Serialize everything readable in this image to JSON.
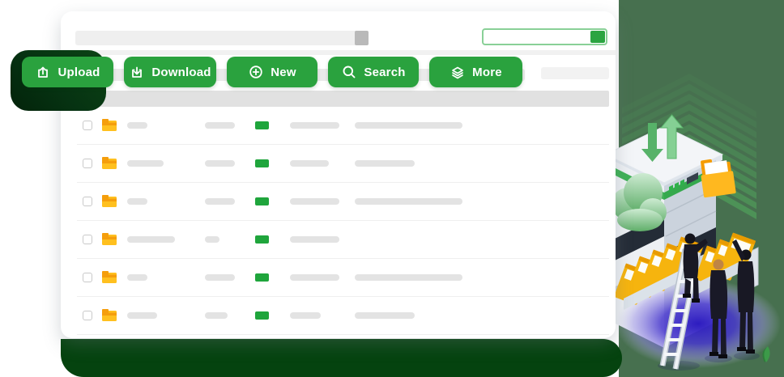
{
  "toolbar": {
    "buttons": [
      {
        "id": "upload",
        "label": "Upload",
        "icon": "upload-icon"
      },
      {
        "id": "download",
        "label": "Download",
        "icon": "download-icon"
      },
      {
        "id": "new",
        "label": "New",
        "icon": "plus-circle-icon"
      },
      {
        "id": "search",
        "label": "Search",
        "icon": "search-icon"
      },
      {
        "id": "more",
        "label": "More",
        "icon": "layers-icon"
      }
    ]
  },
  "file_table": {
    "rows": [
      {
        "checked": false,
        "icon": "folder-icon",
        "name_w": 25,
        "c2_w": 37,
        "badge": true,
        "c4_w": 61,
        "c5_w": 133
      },
      {
        "checked": false,
        "icon": "folder-icon",
        "name_w": 45,
        "c2_w": 37,
        "badge": true,
        "c4_w": 48,
        "c5_w": 74
      },
      {
        "checked": false,
        "icon": "folder-icon",
        "name_w": 25,
        "c2_w": 37,
        "badge": true,
        "c4_w": 61,
        "c5_w": 133
      },
      {
        "checked": false,
        "icon": "folder-icon",
        "name_w": 59,
        "c2_w": 18,
        "badge": true,
        "c4_w": 61,
        "c5_w": 0
      },
      {
        "checked": false,
        "icon": "folder-icon",
        "name_w": 25,
        "c2_w": 37,
        "badge": true,
        "c4_w": 61,
        "c5_w": 133
      },
      {
        "checked": false,
        "icon": "folder-icon",
        "name_w": 37,
        "c2_w": 28,
        "badge": true,
        "c4_w": 38,
        "c5_w": 74
      }
    ]
  },
  "colors": {
    "button_green": "#2AA23E",
    "badge_green": "#1FA53C",
    "bottom_band_green": "#05430F",
    "background_green": "#47704F",
    "progress_border_green": "#89D097",
    "progress_fill_green": "#2BA441",
    "folder_yellow": "#FFC01F",
    "folder_flap_orange": "#F59E0C",
    "purple_base": "#2D1CC0",
    "upload_shadow_dark_green": "#063312"
  }
}
